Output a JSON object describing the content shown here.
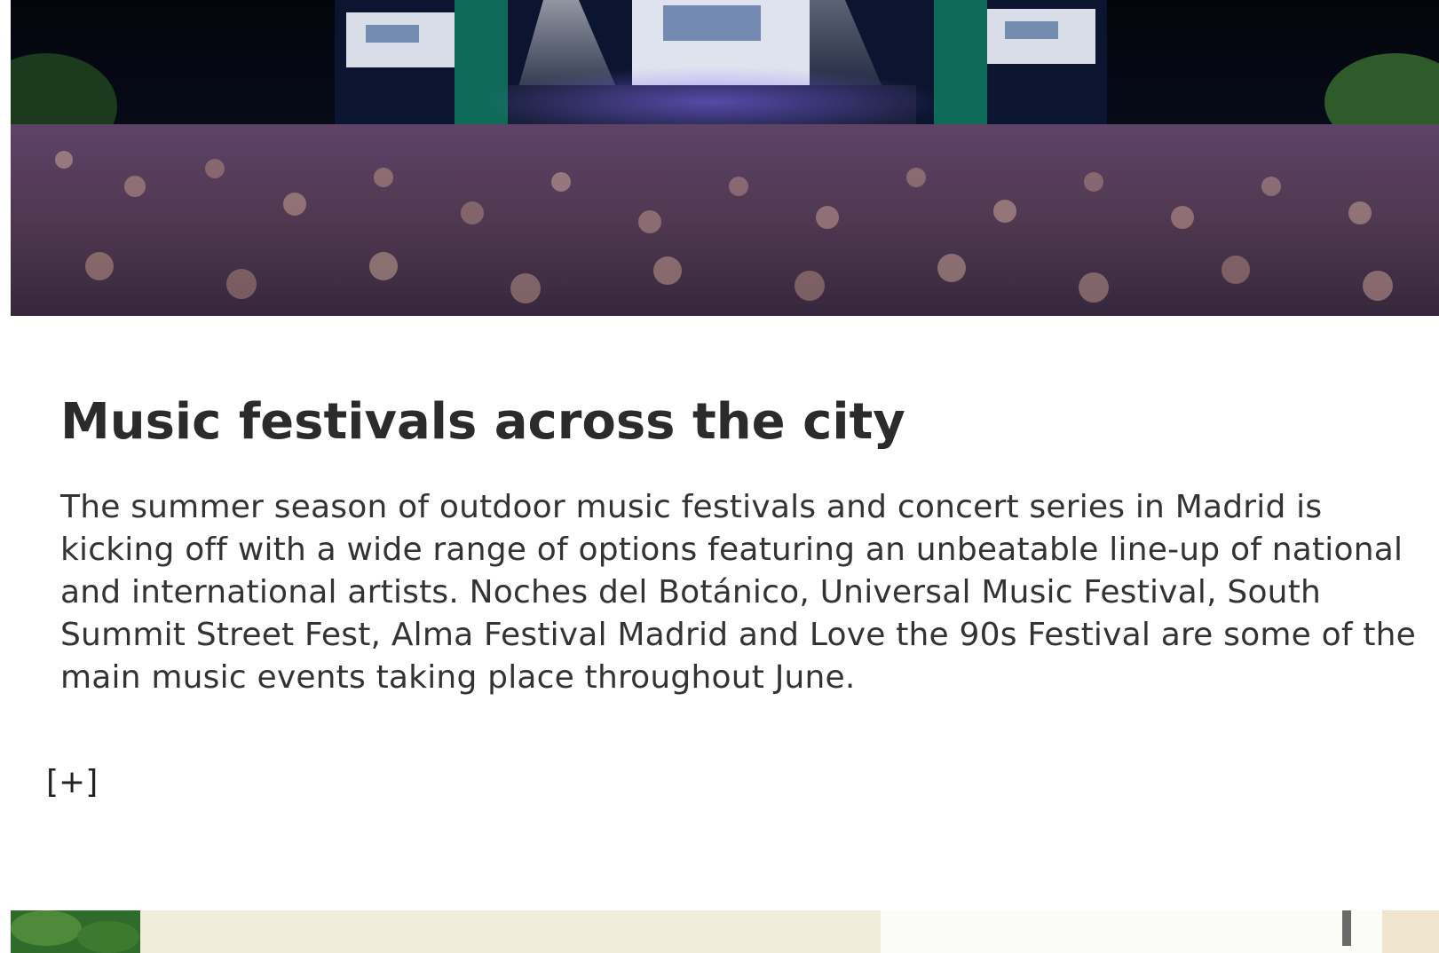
{
  "article": {
    "title": "Music festivals across the city",
    "body": "The summer season of outdoor music festivals and concert series in Madrid is kicking off with a wide range of options featuring an unbeatable line-up of national and international artists. Noches del Botánico, Universal Music Festival, South Summit Street Fest, Alma Festival Madrid and Love the 90s Festival are some of the main music events taking place throughout June.",
    "expand_label": "[+]"
  },
  "colors": {
    "title": "#2b2b2b",
    "body": "#333333",
    "background": "#ffffff"
  }
}
